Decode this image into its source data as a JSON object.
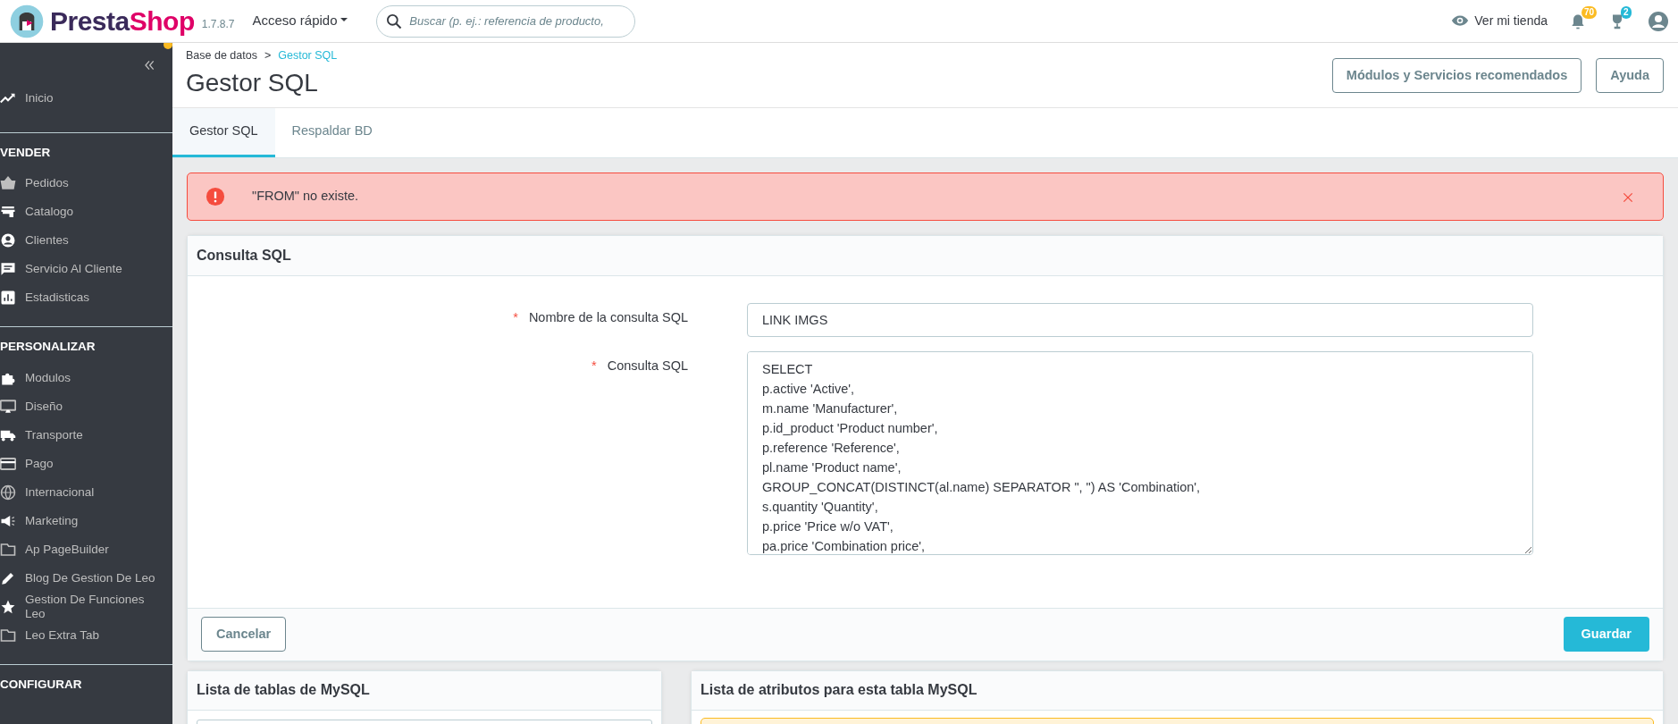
{
  "header": {
    "logo_parts": [
      "Presta",
      "Shop"
    ],
    "version": "1.7.8.7",
    "quick_access": "Acceso rápido",
    "search": {
      "placeholder": "Buscar (p. ej.: referencia de producto,"
    },
    "view_store": "Ver mi tienda",
    "notifications_count": "70",
    "trophy_count": "2"
  },
  "sidebar": {
    "home": "Inicio",
    "sections": [
      {
        "title": "VENDER",
        "items": [
          "Pedidos",
          "Catalogo",
          "Clientes",
          "Servicio Al Cliente",
          "Estadisticas"
        ]
      },
      {
        "title": "PERSONALIZAR",
        "items": [
          "Modulos",
          "Diseño",
          "Transporte",
          "Pago",
          "Internacional",
          "Marketing",
          "Ap PageBuilder",
          "Blog De Gestion De Leo",
          "Gestion De Funciones Leo",
          "Leo Extra Tab"
        ]
      },
      {
        "title": "CONFIGURAR"
      }
    ]
  },
  "breadcrumb": {
    "separator": ">",
    "items": [
      {
        "label": "Base de datos",
        "current": false
      },
      {
        "label": "Gestor SQL",
        "current": true
      }
    ]
  },
  "page_title": "Gestor SQL",
  "toolbar_buttons": [
    "Módulos y Servicios recomendados",
    "Ayuda"
  ],
  "tabs": [
    {
      "label": "Gestor SQL",
      "selected": true
    },
    {
      "label": "Respaldar BD",
      "selected": false
    }
  ],
  "alert": {
    "message": "\"FROM\" no existe."
  },
  "form": {
    "title": "Consulta SQL",
    "fields": [
      {
        "kind": "input",
        "label": "Nombre de la consulta SQL",
        "required_mark": "*",
        "value": "LINK IMGS"
      },
      {
        "kind": "textarea",
        "label": "Consulta SQL",
        "required_mark": "*",
        "lines": [
          "SELECT",
          "p.active 'Active',",
          "m.name 'Manufacturer',",
          "p.id_product 'Product number',",
          "p.reference 'Reference',",
          "pl.name 'Product name',",
          "GROUP_CONCAT(DISTINCT(al.name) SEPARATOR \", \") AS 'Combination',",
          "s.quantity 'Quantity',",
          "p.price 'Price w/o VAT',",
          "pa.price 'Combination price',"
        ]
      }
    ],
    "cancel": "Cancelar",
    "save": "Guardar"
  },
  "tables_panel": {
    "title": "Lista de tablas de MySQL"
  },
  "attributes_panel": {
    "title": "Lista de atributos para esta tabla MySQL"
  }
}
